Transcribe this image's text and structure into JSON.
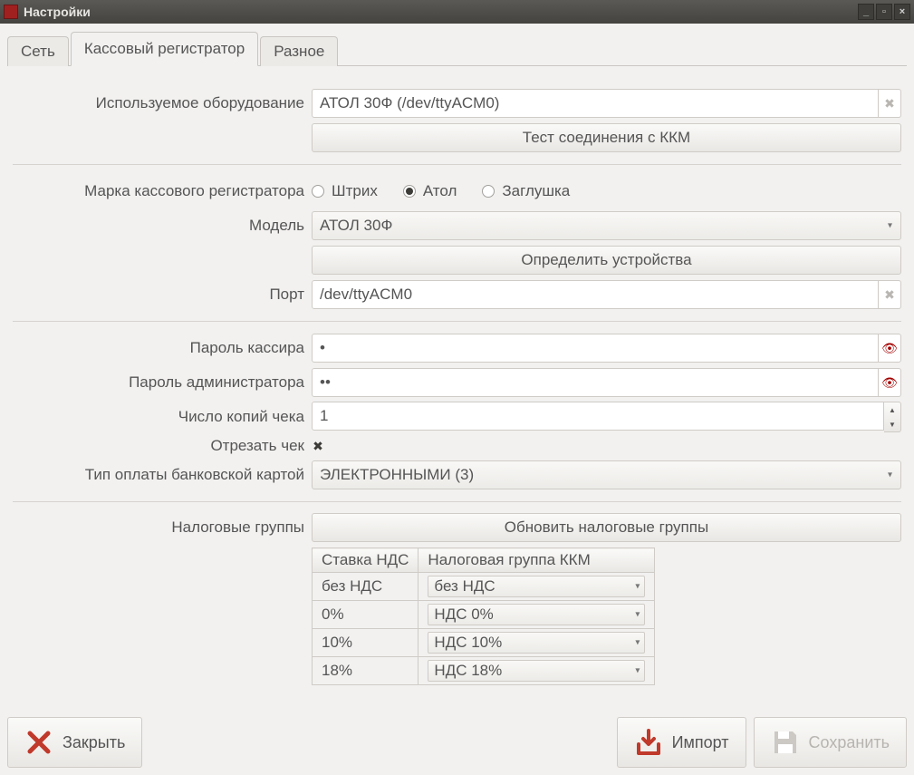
{
  "window": {
    "title": "Настройки"
  },
  "tabs": {
    "network": "Сеть",
    "register": "Кассовый регистратор",
    "misc": "Разное",
    "active": "register"
  },
  "fields": {
    "equipment_label": "Используемое оборудование",
    "equipment_value": "АТОЛ 30Ф (/dev/ttyACM0)",
    "test_connection": "Тест соединения с ККМ",
    "brand_label": "Марка кассового регистратора",
    "brand_options": {
      "shtrih": "Штрих",
      "atol": "Атол",
      "stub": "Заглушка"
    },
    "brand_selected": "atol",
    "model_label": "Модель",
    "model_value": "АТОЛ 30Ф",
    "detect_devices": "Определить устройства",
    "port_label": "Порт",
    "port_value": "/dev/ttyACM0",
    "cashier_pwd_label": "Пароль кассира",
    "cashier_pwd_value": "•",
    "admin_pwd_label": "Пароль администратора",
    "admin_pwd_value": "••",
    "copies_label": "Число копий чека",
    "copies_value": "1",
    "cut_label": "Отрезать чек",
    "cut_checked": true,
    "card_pay_label": "Тип оплаты банковской картой",
    "card_pay_value": "ЭЛЕКТРОННЫМИ (3)",
    "tax_groups_label": "Налоговые группы",
    "refresh_tax_groups": "Обновить налоговые группы",
    "tax_table": {
      "col_rate": "Ставка НДС",
      "col_group": "Налоговая группа ККМ",
      "rows": [
        {
          "rate": "без НДС",
          "group": "без НДС"
        },
        {
          "rate": "0%",
          "group": "НДС 0%"
        },
        {
          "rate": "10%",
          "group": "НДС 10%"
        },
        {
          "rate": "18%",
          "group": "НДС 18%"
        }
      ]
    }
  },
  "footer": {
    "close": "Закрыть",
    "import": "Импорт",
    "save": "Сохранить"
  }
}
